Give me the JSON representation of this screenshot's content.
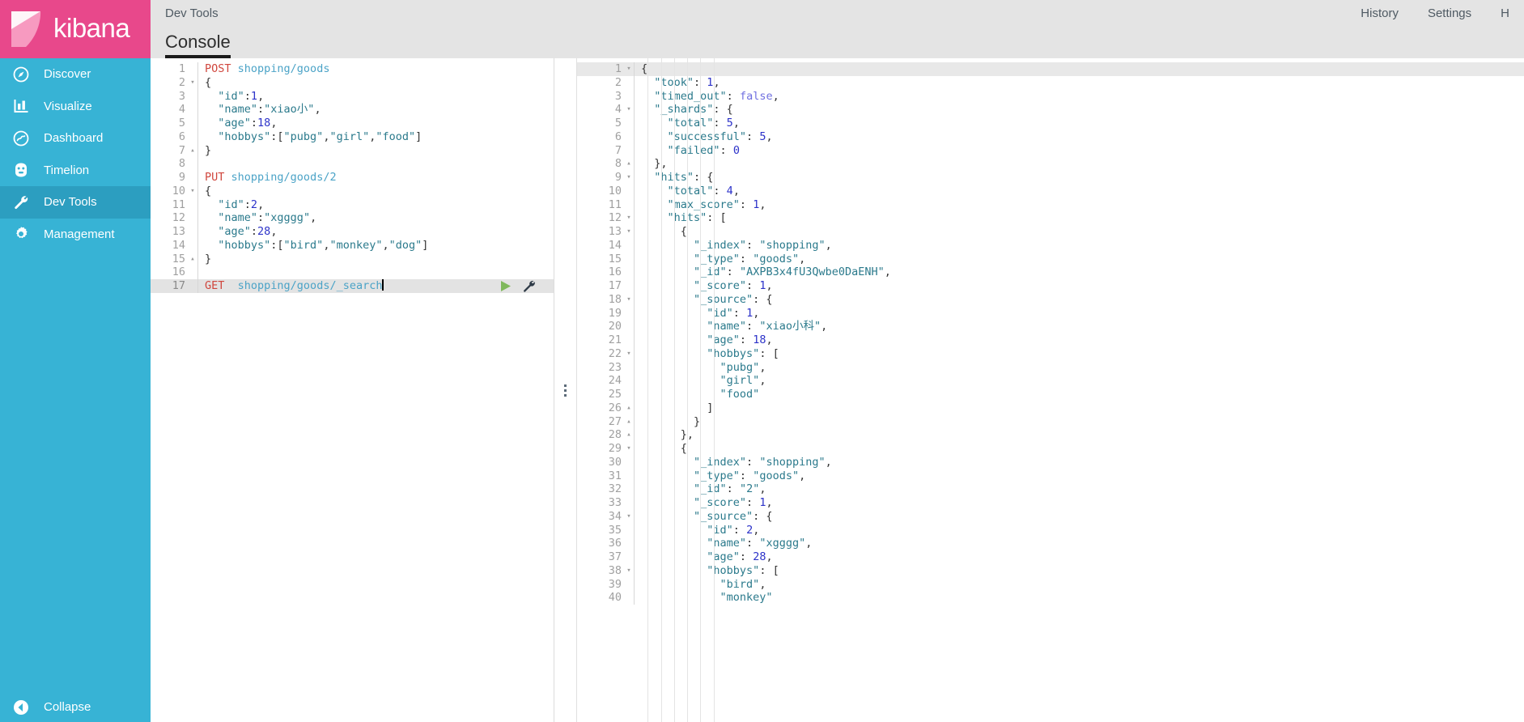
{
  "brand": {
    "name": "kibana",
    "logo_color": "#e8488b",
    "sidebar_color": "#37b3d5"
  },
  "sidebar": {
    "items": [
      {
        "label": "Discover",
        "icon": "compass-icon",
        "active": false
      },
      {
        "label": "Visualize",
        "icon": "bar-chart-icon",
        "active": false
      },
      {
        "label": "Dashboard",
        "icon": "dashboard-icon",
        "active": false
      },
      {
        "label": "Timelion",
        "icon": "timelion-icon",
        "active": false
      },
      {
        "label": "Dev Tools",
        "icon": "wrench-icon",
        "active": true
      },
      {
        "label": "Management",
        "icon": "gear-icon",
        "active": false
      }
    ],
    "collapse": {
      "label": "Collapse",
      "icon": "chevron-left-circle-icon"
    }
  },
  "header": {
    "title": "Dev Tools",
    "links": [
      "History",
      "Settings",
      "H"
    ]
  },
  "tabs": [
    {
      "label": "Console",
      "active": true
    }
  ],
  "editor": {
    "active_line": 17,
    "cursor_line": 17,
    "request_text": "GET  shopping/goods/_search",
    "actions": {
      "play": "play-icon",
      "wrench": "wrench-icon"
    },
    "lines": [
      {
        "n": 1,
        "fold": "",
        "tokens": [
          {
            "t": "POST",
            "c": "tk-method"
          },
          {
            "t": " ",
            "c": "tk-plain"
          },
          {
            "t": "shopping/goods",
            "c": "tk-url"
          }
        ]
      },
      {
        "n": 2,
        "fold": "▾",
        "tokens": [
          {
            "t": "{",
            "c": "tk-punct"
          }
        ]
      },
      {
        "n": 3,
        "fold": "",
        "tokens": [
          {
            "t": "  \"id\"",
            "c": "tk-key"
          },
          {
            "t": ":",
            "c": "tk-punct"
          },
          {
            "t": "1",
            "c": "tk-num"
          },
          {
            "t": ",",
            "c": "tk-punct"
          }
        ]
      },
      {
        "n": 4,
        "fold": "",
        "tokens": [
          {
            "t": "  \"name\"",
            "c": "tk-key"
          },
          {
            "t": ":",
            "c": "tk-punct"
          },
          {
            "t": "\"xiao小\"",
            "c": "tk-str"
          },
          {
            "t": ",",
            "c": "tk-punct"
          }
        ]
      },
      {
        "n": 5,
        "fold": "",
        "tokens": [
          {
            "t": "  \"age\"",
            "c": "tk-key"
          },
          {
            "t": ":",
            "c": "tk-punct"
          },
          {
            "t": "18",
            "c": "tk-num"
          },
          {
            "t": ",",
            "c": "tk-punct"
          }
        ]
      },
      {
        "n": 6,
        "fold": "",
        "tokens": [
          {
            "t": "  \"hobbys\"",
            "c": "tk-key"
          },
          {
            "t": ":[",
            "c": "tk-punct"
          },
          {
            "t": "\"pubg\"",
            "c": "tk-str"
          },
          {
            "t": ",",
            "c": "tk-punct"
          },
          {
            "t": "\"girl\"",
            "c": "tk-str"
          },
          {
            "t": ",",
            "c": "tk-punct"
          },
          {
            "t": "\"food\"",
            "c": "tk-str"
          },
          {
            "t": "]",
            "c": "tk-punct"
          }
        ]
      },
      {
        "n": 7,
        "fold": "▴",
        "tokens": [
          {
            "t": "}",
            "c": "tk-punct"
          }
        ]
      },
      {
        "n": 8,
        "fold": "",
        "tokens": []
      },
      {
        "n": 9,
        "fold": "",
        "tokens": [
          {
            "t": "PUT",
            "c": "tk-method"
          },
          {
            "t": " ",
            "c": "tk-plain"
          },
          {
            "t": "shopping/goods/2",
            "c": "tk-url"
          }
        ]
      },
      {
        "n": 10,
        "fold": "▾",
        "tokens": [
          {
            "t": "{",
            "c": "tk-punct"
          }
        ]
      },
      {
        "n": 11,
        "fold": "",
        "tokens": [
          {
            "t": "  \"id\"",
            "c": "tk-key"
          },
          {
            "t": ":",
            "c": "tk-punct"
          },
          {
            "t": "2",
            "c": "tk-num"
          },
          {
            "t": ",",
            "c": "tk-punct"
          }
        ]
      },
      {
        "n": 12,
        "fold": "",
        "tokens": [
          {
            "t": "  \"name\"",
            "c": "tk-key"
          },
          {
            "t": ":",
            "c": "tk-punct"
          },
          {
            "t": "\"xgggg\"",
            "c": "tk-str"
          },
          {
            "t": ",",
            "c": "tk-punct"
          }
        ]
      },
      {
        "n": 13,
        "fold": "",
        "tokens": [
          {
            "t": "  \"age\"",
            "c": "tk-key"
          },
          {
            "t": ":",
            "c": "tk-punct"
          },
          {
            "t": "28",
            "c": "tk-num"
          },
          {
            "t": ",",
            "c": "tk-punct"
          }
        ]
      },
      {
        "n": 14,
        "fold": "",
        "tokens": [
          {
            "t": "  \"hobbys\"",
            "c": "tk-key"
          },
          {
            "t": ":[",
            "c": "tk-punct"
          },
          {
            "t": "\"bird\"",
            "c": "tk-str"
          },
          {
            "t": ",",
            "c": "tk-punct"
          },
          {
            "t": "\"monkey\"",
            "c": "tk-str"
          },
          {
            "t": ",",
            "c": "tk-punct"
          },
          {
            "t": "\"dog\"",
            "c": "tk-str"
          },
          {
            "t": "]",
            "c": "tk-punct"
          }
        ]
      },
      {
        "n": 15,
        "fold": "▴",
        "tokens": [
          {
            "t": "}",
            "c": "tk-punct"
          }
        ]
      },
      {
        "n": 16,
        "fold": "",
        "tokens": []
      },
      {
        "n": 17,
        "fold": "",
        "highlight": true,
        "caret": true,
        "tokens": [
          {
            "t": "GET",
            "c": "tk-method"
          },
          {
            "t": "  ",
            "c": "tk-plain"
          },
          {
            "t": "shopping/goods/_search",
            "c": "tk-url"
          }
        ]
      }
    ]
  },
  "response": {
    "lines": [
      {
        "n": 1,
        "fold": "▾",
        "highlight": true,
        "tokens": [
          {
            "t": "{",
            "c": "tk-punct"
          }
        ]
      },
      {
        "n": 2,
        "fold": "",
        "tokens": [
          {
            "t": "  \"took\"",
            "c": "tk-key"
          },
          {
            "t": ": ",
            "c": "tk-punct"
          },
          {
            "t": "1",
            "c": "tk-num"
          },
          {
            "t": ",",
            "c": "tk-punct"
          }
        ]
      },
      {
        "n": 3,
        "fold": "",
        "tokens": [
          {
            "t": "  \"timed_out\"",
            "c": "tk-key"
          },
          {
            "t": ": ",
            "c": "tk-punct"
          },
          {
            "t": "false",
            "c": "tk-bool"
          },
          {
            "t": ",",
            "c": "tk-punct"
          }
        ]
      },
      {
        "n": 4,
        "fold": "▾",
        "tokens": [
          {
            "t": "  \"_shards\"",
            "c": "tk-key"
          },
          {
            "t": ": {",
            "c": "tk-punct"
          }
        ]
      },
      {
        "n": 5,
        "fold": "",
        "tokens": [
          {
            "t": "    \"total\"",
            "c": "tk-key"
          },
          {
            "t": ": ",
            "c": "tk-punct"
          },
          {
            "t": "5",
            "c": "tk-num"
          },
          {
            "t": ",",
            "c": "tk-punct"
          }
        ]
      },
      {
        "n": 6,
        "fold": "",
        "tokens": [
          {
            "t": "    \"successful\"",
            "c": "tk-key"
          },
          {
            "t": ": ",
            "c": "tk-punct"
          },
          {
            "t": "5",
            "c": "tk-num"
          },
          {
            "t": ",",
            "c": "tk-punct"
          }
        ]
      },
      {
        "n": 7,
        "fold": "",
        "tokens": [
          {
            "t": "    \"failed\"",
            "c": "tk-key"
          },
          {
            "t": ": ",
            "c": "tk-punct"
          },
          {
            "t": "0",
            "c": "tk-num"
          }
        ]
      },
      {
        "n": 8,
        "fold": "▴",
        "tokens": [
          {
            "t": "  },",
            "c": "tk-punct"
          }
        ]
      },
      {
        "n": 9,
        "fold": "▾",
        "tokens": [
          {
            "t": "  \"hits\"",
            "c": "tk-key"
          },
          {
            "t": ": {",
            "c": "tk-punct"
          }
        ]
      },
      {
        "n": 10,
        "fold": "",
        "tokens": [
          {
            "t": "    \"total\"",
            "c": "tk-key"
          },
          {
            "t": ": ",
            "c": "tk-punct"
          },
          {
            "t": "4",
            "c": "tk-num"
          },
          {
            "t": ",",
            "c": "tk-punct"
          }
        ]
      },
      {
        "n": 11,
        "fold": "",
        "tokens": [
          {
            "t": "    \"max_score\"",
            "c": "tk-key"
          },
          {
            "t": ": ",
            "c": "tk-punct"
          },
          {
            "t": "1",
            "c": "tk-num"
          },
          {
            "t": ",",
            "c": "tk-punct"
          }
        ]
      },
      {
        "n": 12,
        "fold": "▾",
        "tokens": [
          {
            "t": "    \"hits\"",
            "c": "tk-key"
          },
          {
            "t": ": [",
            "c": "tk-punct"
          }
        ]
      },
      {
        "n": 13,
        "fold": "▾",
        "tokens": [
          {
            "t": "      {",
            "c": "tk-punct"
          }
        ]
      },
      {
        "n": 14,
        "fold": "",
        "tokens": [
          {
            "t": "        \"_index\"",
            "c": "tk-key"
          },
          {
            "t": ": ",
            "c": "tk-punct"
          },
          {
            "t": "\"shopping\"",
            "c": "tk-str"
          },
          {
            "t": ",",
            "c": "tk-punct"
          }
        ]
      },
      {
        "n": 15,
        "fold": "",
        "tokens": [
          {
            "t": "        \"_type\"",
            "c": "tk-key"
          },
          {
            "t": ": ",
            "c": "tk-punct"
          },
          {
            "t": "\"goods\"",
            "c": "tk-str"
          },
          {
            "t": ",",
            "c": "tk-punct"
          }
        ]
      },
      {
        "n": 16,
        "fold": "",
        "tokens": [
          {
            "t": "        \"_id\"",
            "c": "tk-key"
          },
          {
            "t": ": ",
            "c": "tk-punct"
          },
          {
            "t": "\"AXPB3x4fU3Qwbe0DaENH\"",
            "c": "tk-str"
          },
          {
            "t": ",",
            "c": "tk-punct"
          }
        ]
      },
      {
        "n": 17,
        "fold": "",
        "tokens": [
          {
            "t": "        \"_score\"",
            "c": "tk-key"
          },
          {
            "t": ": ",
            "c": "tk-punct"
          },
          {
            "t": "1",
            "c": "tk-num"
          },
          {
            "t": ",",
            "c": "tk-punct"
          }
        ]
      },
      {
        "n": 18,
        "fold": "▾",
        "tokens": [
          {
            "t": "        \"_source\"",
            "c": "tk-key"
          },
          {
            "t": ": {",
            "c": "tk-punct"
          }
        ]
      },
      {
        "n": 19,
        "fold": "",
        "tokens": [
          {
            "t": "          \"id\"",
            "c": "tk-key"
          },
          {
            "t": ": ",
            "c": "tk-punct"
          },
          {
            "t": "1",
            "c": "tk-num"
          },
          {
            "t": ",",
            "c": "tk-punct"
          }
        ]
      },
      {
        "n": 20,
        "fold": "",
        "tokens": [
          {
            "t": "          \"name\"",
            "c": "tk-key"
          },
          {
            "t": ": ",
            "c": "tk-punct"
          },
          {
            "t": "\"xiao小科\"",
            "c": "tk-str"
          },
          {
            "t": ",",
            "c": "tk-punct"
          }
        ]
      },
      {
        "n": 21,
        "fold": "",
        "tokens": [
          {
            "t": "          \"age\"",
            "c": "tk-key"
          },
          {
            "t": ": ",
            "c": "tk-punct"
          },
          {
            "t": "18",
            "c": "tk-num"
          },
          {
            "t": ",",
            "c": "tk-punct"
          }
        ]
      },
      {
        "n": 22,
        "fold": "▾",
        "tokens": [
          {
            "t": "          \"hobbys\"",
            "c": "tk-key"
          },
          {
            "t": ": [",
            "c": "tk-punct"
          }
        ]
      },
      {
        "n": 23,
        "fold": "",
        "tokens": [
          {
            "t": "            \"pubg\"",
            "c": "tk-str"
          },
          {
            "t": ",",
            "c": "tk-punct"
          }
        ]
      },
      {
        "n": 24,
        "fold": "",
        "tokens": [
          {
            "t": "            \"girl\"",
            "c": "tk-str"
          },
          {
            "t": ",",
            "c": "tk-punct"
          }
        ]
      },
      {
        "n": 25,
        "fold": "",
        "tokens": [
          {
            "t": "            \"food\"",
            "c": "tk-str"
          }
        ]
      },
      {
        "n": 26,
        "fold": "▴",
        "tokens": [
          {
            "t": "          ]",
            "c": "tk-punct"
          }
        ]
      },
      {
        "n": 27,
        "fold": "▴",
        "tokens": [
          {
            "t": "        }",
            "c": "tk-punct"
          }
        ]
      },
      {
        "n": 28,
        "fold": "▴",
        "tokens": [
          {
            "t": "      },",
            "c": "tk-punct"
          }
        ]
      },
      {
        "n": 29,
        "fold": "▾",
        "tokens": [
          {
            "t": "      {",
            "c": "tk-punct"
          }
        ]
      },
      {
        "n": 30,
        "fold": "",
        "tokens": [
          {
            "t": "        \"_index\"",
            "c": "tk-key"
          },
          {
            "t": ": ",
            "c": "tk-punct"
          },
          {
            "t": "\"shopping\"",
            "c": "tk-str"
          },
          {
            "t": ",",
            "c": "tk-punct"
          }
        ]
      },
      {
        "n": 31,
        "fold": "",
        "tokens": [
          {
            "t": "        \"_type\"",
            "c": "tk-key"
          },
          {
            "t": ": ",
            "c": "tk-punct"
          },
          {
            "t": "\"goods\"",
            "c": "tk-str"
          },
          {
            "t": ",",
            "c": "tk-punct"
          }
        ]
      },
      {
        "n": 32,
        "fold": "",
        "tokens": [
          {
            "t": "        \"_id\"",
            "c": "tk-key"
          },
          {
            "t": ": ",
            "c": "tk-punct"
          },
          {
            "t": "\"2\"",
            "c": "tk-str"
          },
          {
            "t": ",",
            "c": "tk-punct"
          }
        ]
      },
      {
        "n": 33,
        "fold": "",
        "tokens": [
          {
            "t": "        \"_score\"",
            "c": "tk-key"
          },
          {
            "t": ": ",
            "c": "tk-punct"
          },
          {
            "t": "1",
            "c": "tk-num"
          },
          {
            "t": ",",
            "c": "tk-punct"
          }
        ]
      },
      {
        "n": 34,
        "fold": "▾",
        "tokens": [
          {
            "t": "        \"_source\"",
            "c": "tk-key"
          },
          {
            "t": ": {",
            "c": "tk-punct"
          }
        ]
      },
      {
        "n": 35,
        "fold": "",
        "tokens": [
          {
            "t": "          \"id\"",
            "c": "tk-key"
          },
          {
            "t": ": ",
            "c": "tk-punct"
          },
          {
            "t": "2",
            "c": "tk-num"
          },
          {
            "t": ",",
            "c": "tk-punct"
          }
        ]
      },
      {
        "n": 36,
        "fold": "",
        "tokens": [
          {
            "t": "          \"name\"",
            "c": "tk-key"
          },
          {
            "t": ": ",
            "c": "tk-punct"
          },
          {
            "t": "\"xgggg\"",
            "c": "tk-str"
          },
          {
            "t": ",",
            "c": "tk-punct"
          }
        ]
      },
      {
        "n": 37,
        "fold": "",
        "tokens": [
          {
            "t": "          \"age\"",
            "c": "tk-key"
          },
          {
            "t": ": ",
            "c": "tk-punct"
          },
          {
            "t": "28",
            "c": "tk-num"
          },
          {
            "t": ",",
            "c": "tk-punct"
          }
        ]
      },
      {
        "n": 38,
        "fold": "▾",
        "tokens": [
          {
            "t": "          \"hobbys\"",
            "c": "tk-key"
          },
          {
            "t": ": [",
            "c": "tk-punct"
          }
        ]
      },
      {
        "n": 39,
        "fold": "",
        "tokens": [
          {
            "t": "            \"bird\"",
            "c": "tk-str"
          },
          {
            "t": ",",
            "c": "tk-punct"
          }
        ]
      },
      {
        "n": 40,
        "fold": "",
        "tokens": [
          {
            "t": "            \"monkey\"",
            "c": "tk-str"
          }
        ]
      }
    ]
  }
}
